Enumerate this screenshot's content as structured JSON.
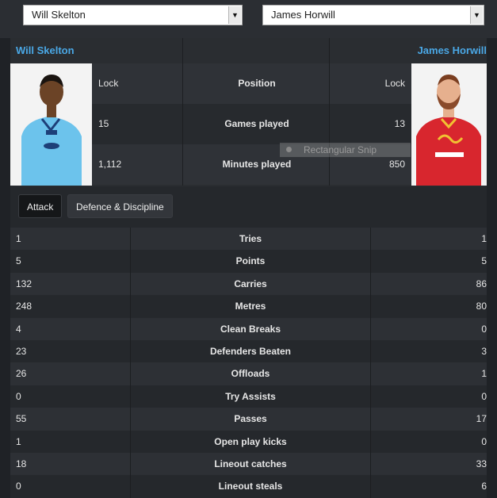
{
  "selectors": {
    "left": {
      "value": "Will Skelton"
    },
    "right": {
      "value": "James Horwill"
    }
  },
  "comparison": {
    "left_player": "Will Skelton",
    "right_player": "James Horwill",
    "rows": [
      {
        "label": "Position",
        "left": "Lock",
        "right": "Lock"
      },
      {
        "label": "Games played",
        "left": "15",
        "right": "13"
      },
      {
        "label": "Minutes played",
        "left": "1,112",
        "right": "850"
      }
    ]
  },
  "overlay": {
    "snip_label": "Rectangular Snip"
  },
  "tabs": [
    {
      "label": "Attack",
      "active": true
    },
    {
      "label": "Defence & Discipline",
      "active": false
    }
  ],
  "stats": [
    {
      "label": "Tries",
      "left": "1",
      "right": "1"
    },
    {
      "label": "Points",
      "left": "5",
      "right": "5"
    },
    {
      "label": "Carries",
      "left": "132",
      "right": "86"
    },
    {
      "label": "Metres",
      "left": "248",
      "right": "80"
    },
    {
      "label": "Clean Breaks",
      "left": "4",
      "right": "0"
    },
    {
      "label": "Defenders Beaten",
      "left": "23",
      "right": "3"
    },
    {
      "label": "Offloads",
      "left": "26",
      "right": "1"
    },
    {
      "label": "Try Assists",
      "left": "0",
      "right": "0"
    },
    {
      "label": "Passes",
      "left": "55",
      "right": "17"
    },
    {
      "label": "Open play kicks",
      "left": "1",
      "right": "0"
    },
    {
      "label": "Lineout catches",
      "left": "18",
      "right": "33"
    },
    {
      "label": "Lineout steals",
      "left": "0",
      "right": "6"
    }
  ],
  "colors": {
    "accent": "#4aa8e6",
    "left_jersey": "#6cc3ec",
    "right_jersey": "#d8262e"
  }
}
